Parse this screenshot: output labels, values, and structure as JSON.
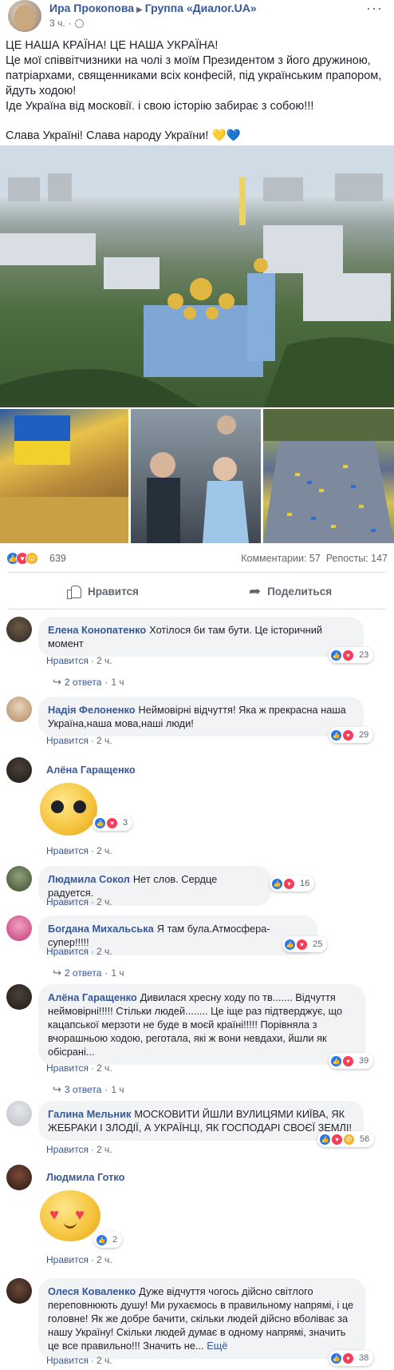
{
  "post": {
    "author": "Ира Прокопова",
    "group": "Группа «Диалог.UA»",
    "time": "3 ч.",
    "text": {
      "line1": "ЦЕ НАША КРАЇНА! ЦЕ НАША УКРАЇНА!",
      "line2": "Це мої співвітчизники на чолі з моїм Президентом з його дружиною, патріархами, священниками всіх конфесій, під українським прапором, йдуть ходою!",
      "line3": "Іде Україна від московії. і свою історію забирає з собою!!!",
      "line4": "Слава Україні! Слава народу України! 💛💙"
    },
    "reactions_count": "639",
    "comments_label": "Комментарии: 57",
    "shares_label": "Репосты: 147",
    "like_label": "Нравится",
    "share_label": "Поделиться"
  },
  "comments": [
    {
      "author": "Елена Конопатенко",
      "text": "Хотілося би там бути. Це історичний момент",
      "like": "Нравится",
      "time": "2 ч.",
      "reacts": "23",
      "replies": "2 ответа",
      "replies_time": "1 ч"
    },
    {
      "author": "Надія Фелоненко",
      "text": "Неймовірні відчуття! Яка ж прекрасна наша Україна,наша мова,наші люди!",
      "like": "Нравится",
      "time": "2 ч.",
      "reacts": "29"
    },
    {
      "author": "Алёна Гаращенко",
      "text": "",
      "like": "Нравится",
      "time": "2 ч.",
      "reacts": "3"
    },
    {
      "author": "Людмила Сокол",
      "text": "Нет слов. Сердце радуется.",
      "like": "Нравится",
      "time": "2 ч.",
      "reacts": "16"
    },
    {
      "author": "Богдана Михальська",
      "text": "Я там була.Атмосфера-супер!!!!!",
      "like": "Нравится",
      "time": "2 ч.",
      "reacts": "25",
      "replies": "2 ответа",
      "replies_time": "1 ч"
    },
    {
      "author": "Алёна Гаращенко",
      "text": "Дивилася хресну ходу по тв....... Відчуття неймовірні!!!!! Стільки людей........ Це іще раз підтверджує, що кацапської мерзоти не буде в моєй країні!!!!! Порівняла з вчорашньою ходою, реготала, які ж вони невдахи, йшли як обісрані...",
      "like": "Нравится",
      "time": "2 ч.",
      "reacts": "39",
      "replies": "3 ответа",
      "replies_time": "1 ч"
    },
    {
      "author": "Галина Мельник",
      "text": "МОСКОВИТИ ЙШЛИ ВУЛИЦЯМИ КИЇВА, ЯК ЖЕБРАКИ І ЗЛОДІЇ, А УКРАЇНЦІ, ЯК ГОСПОДАРІ СВОЄЇ ЗЕМЛІ!",
      "like": "Нравится",
      "time": "2 ч.",
      "reacts": "56"
    },
    {
      "author": "Людмила Готко",
      "text": "",
      "like": "Нравится",
      "time": "2 ч.",
      "reacts": "2"
    },
    {
      "author": "Олеся Коваленко",
      "text": "Дуже відчуття чогось дійсно світлого переповнюють душу! Ми рухаємось в правильному напрямі, і це головне! Як же добре бачити, скільки людей дійсно вболіває за нашу Україну! Скільки людей думає в одному напрямі, значить це все правильно!!! Значить не...",
      "see_more": "Ещё",
      "like": "Нравится",
      "time": "2 ч.",
      "reacts": "38"
    }
  ],
  "colors": {
    "link": "#385898",
    "like_blue": "#2078f4",
    "love_red": "#f33e58",
    "bubble_bg": "#f2f3f5"
  }
}
